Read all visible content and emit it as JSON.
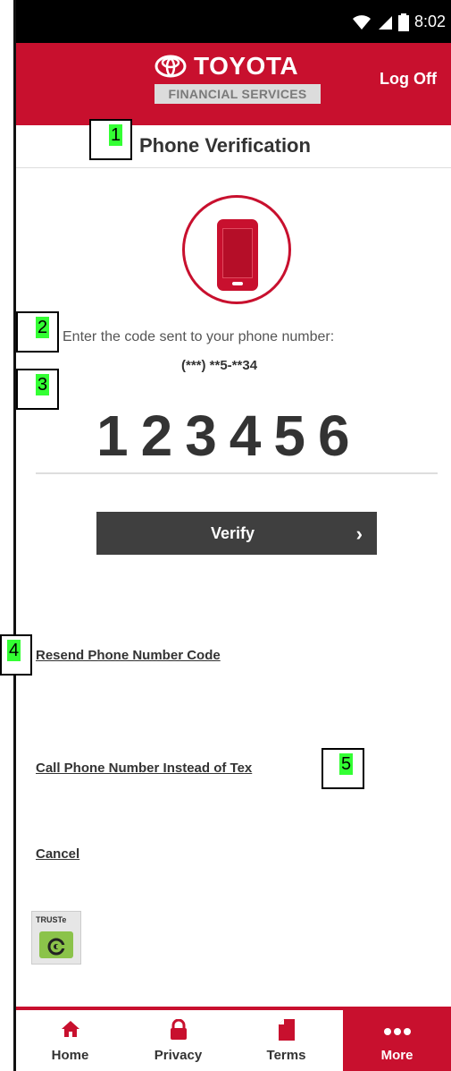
{
  "status_bar": {
    "time": "8:02"
  },
  "header": {
    "brand_name": "TOYOTA",
    "brand_sub": "FINANCIAL SERVICES",
    "logoff_label": "Log Off"
  },
  "page": {
    "title": "Phone Verification"
  },
  "callouts": [
    "1",
    "2",
    "3",
    "4",
    "5"
  ],
  "verification": {
    "instruction": "Enter the code sent to your phone number:",
    "masked_phone": "(***) **5-**34",
    "code": "123456",
    "verify_label": "Verify"
  },
  "links": {
    "resend": "Resend Phone Number Code",
    "call": "Call Phone Number Instead of Tex",
    "cancel": "Cancel"
  },
  "badge": {
    "label": "TRUSTe"
  },
  "nav": {
    "items": [
      {
        "label": "Home",
        "icon": "home-icon"
      },
      {
        "label": "Privacy",
        "icon": "lock-icon"
      },
      {
        "label": "Terms",
        "icon": "document-icon"
      },
      {
        "label": "More",
        "icon": "more-icon"
      }
    ]
  },
  "colors": {
    "brand_red": "#c8102e",
    "button_dark": "#3f3f3f",
    "callout_highlight": "#33ff33"
  }
}
